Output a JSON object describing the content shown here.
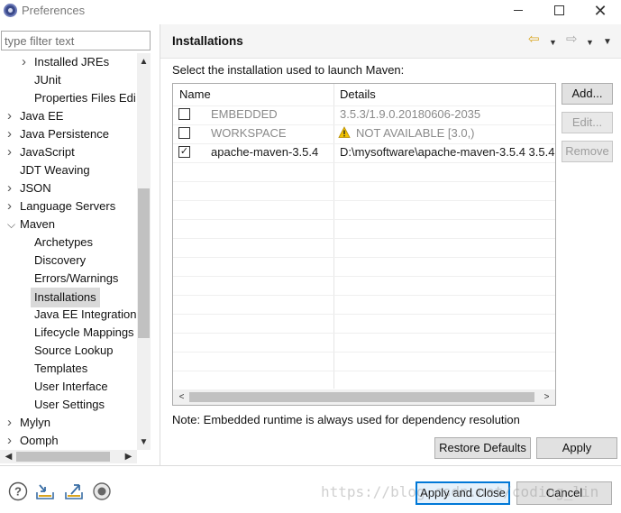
{
  "window": {
    "title": "Preferences",
    "controls": {
      "minimize": "",
      "maximize": "",
      "close": "✕"
    }
  },
  "sidebar": {
    "filter_placeholder": "type filter text",
    "items": [
      {
        "label": "Installed JREs",
        "level": 1,
        "twisty": "collapsed"
      },
      {
        "label": "JUnit",
        "level": 1,
        "twisty": "none"
      },
      {
        "label": "Properties Files Edi",
        "level": 1,
        "twisty": "none"
      },
      {
        "label": "Java EE",
        "level": 0,
        "twisty": "collapsed"
      },
      {
        "label": "Java Persistence",
        "level": 0,
        "twisty": "collapsed"
      },
      {
        "label": "JavaScript",
        "level": 0,
        "twisty": "collapsed"
      },
      {
        "label": "JDT Weaving",
        "level": 0,
        "twisty": "none"
      },
      {
        "label": "JSON",
        "level": 0,
        "twisty": "collapsed"
      },
      {
        "label": "Language Servers",
        "level": 0,
        "twisty": "collapsed"
      },
      {
        "label": "Maven",
        "level": 0,
        "twisty": "expanded"
      },
      {
        "label": "Archetypes",
        "level": 1,
        "twisty": "none"
      },
      {
        "label": "Discovery",
        "level": 1,
        "twisty": "none"
      },
      {
        "label": "Errors/Warnings",
        "level": 1,
        "twisty": "none"
      },
      {
        "label": "Installations",
        "level": 1,
        "twisty": "none",
        "selected": true
      },
      {
        "label": "Java EE Integration",
        "level": 1,
        "twisty": "none"
      },
      {
        "label": "Lifecycle Mappings",
        "level": 1,
        "twisty": "none"
      },
      {
        "label": "Source Lookup",
        "level": 1,
        "twisty": "none"
      },
      {
        "label": "Templates",
        "level": 1,
        "twisty": "none"
      },
      {
        "label": "User Interface",
        "level": 1,
        "twisty": "none"
      },
      {
        "label": "User Settings",
        "level": 1,
        "twisty": "none"
      },
      {
        "label": "Mylyn",
        "level": 0,
        "twisty": "collapsed"
      },
      {
        "label": "Oomph",
        "level": 0,
        "twisty": "collapsed"
      }
    ]
  },
  "page": {
    "title": "Installations",
    "instruction": "Select the installation used to launch Maven:",
    "table": {
      "columns": [
        "Name",
        "Details"
      ],
      "rows": [
        {
          "checked": false,
          "name": "EMBEDDED",
          "details": "3.5.3/1.9.0.20180606-2035",
          "dim": true,
          "warning": false
        },
        {
          "checked": false,
          "name": "WORKSPACE",
          "details": "NOT AVAILABLE [3.0,)",
          "dim": true,
          "warning": true
        },
        {
          "checked": true,
          "name": "apache-maven-3.5.4",
          "details": "D:\\mysoftware\\apache-maven-3.5.4 3.5.4",
          "dim": false,
          "warning": false
        }
      ]
    },
    "buttons": {
      "add": "Add...",
      "edit": "Edit...",
      "remove": "Remove"
    },
    "note": "Note: Embedded runtime is always used for dependency resolution",
    "restore_defaults": "Restore Defaults",
    "apply": "Apply"
  },
  "footer": {
    "apply_and_close": "Apply and Close",
    "cancel": "Cancel",
    "icons": [
      "help-icon",
      "import-icon",
      "export-icon",
      "record-icon"
    ]
  },
  "watermark": "https://blog.csdn.net/coding_lin",
  "colors": {
    "accent": "#0078d7",
    "warning": "#f2c200",
    "back_arrow": "#d9a520"
  }
}
